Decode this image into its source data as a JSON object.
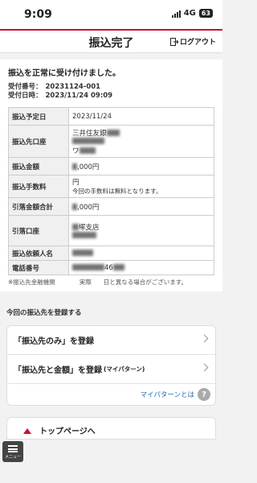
{
  "status": {
    "time": "9:09",
    "network": "4G",
    "battery": "63"
  },
  "header": {
    "title": "振込完了",
    "logout": "ログアウト"
  },
  "result": {
    "message": "振込を正常に受け付けました。",
    "receipt_label": "受付番号：",
    "receipt_value": "20231124-001",
    "datetime_label": "受付日時：",
    "datetime_value": "2023/11/24 09:09"
  },
  "details": [
    {
      "key": "振込予定日",
      "value": "2023/11/24"
    },
    {
      "key": "振込先口座",
      "value": "三井住友銀",
      "extra": "ワ"
    },
    {
      "key": "振込金額",
      "value": ",000円"
    },
    {
      "key": "振込手数料",
      "value": "円",
      "extra": "今回の手数料は無料となります。"
    },
    {
      "key": "引落金額合計",
      "value": ",000円"
    },
    {
      "key": "引落口座",
      "value": "塚支店"
    },
    {
      "key": "振込依頼人名",
      "value": ""
    },
    {
      "key": "電話番号",
      "value": "46"
    }
  ],
  "note": "※振込先金融機関　　　　実際　　日と異なる場合がございます。",
  "register": {
    "section_title": "今回の振込先を登録する",
    "option1": "「振込先のみ」を登録",
    "option2": "「振込先と金額」を登録",
    "option2_sub": "(マイパターン)",
    "mypattern_link": "マイパターンとは",
    "help": "?"
  },
  "bottom": {
    "menu_label": "メニュー",
    "toppage": "トップページへ"
  }
}
